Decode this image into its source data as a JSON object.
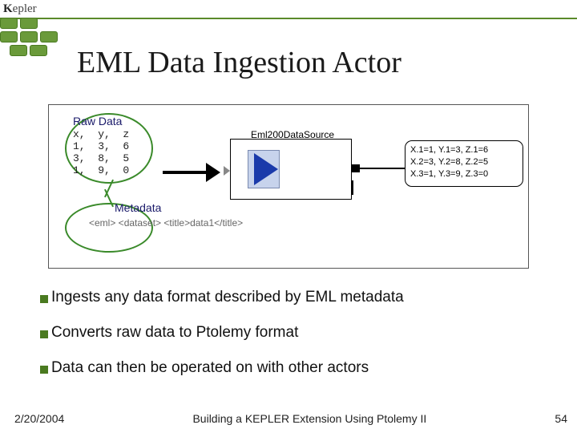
{
  "header": {
    "logo_text": "Kepler"
  },
  "title": "EML Data Ingestion Actor",
  "diagram": {
    "raw_data_label": "Raw Data",
    "raw_data_grid": "x,  y,  z\n1,  3,  6\n3,  8,  5\n1,  9,  0",
    "metadata_label": "Metadata",
    "metadata_xml": "<eml>\n   <dataset>\n      <title>data1</title>",
    "actor_label": "Eml200DataSource",
    "output_text": "X.1=1, Y.1=3, Z.1=6\nX.2=3, Y.2=8, Z.2=5\nX.3=1, Y.3=9, Z.3=0"
  },
  "bullets": [
    "Ingests any data format described by EML metadata",
    "Converts raw data to Ptolemy format",
    "Data can then be operated on with other actors"
  ],
  "footer": {
    "date": "2/20/2004",
    "center": "Building a KEPLER Extension Using Ptolemy II",
    "page": "54"
  }
}
